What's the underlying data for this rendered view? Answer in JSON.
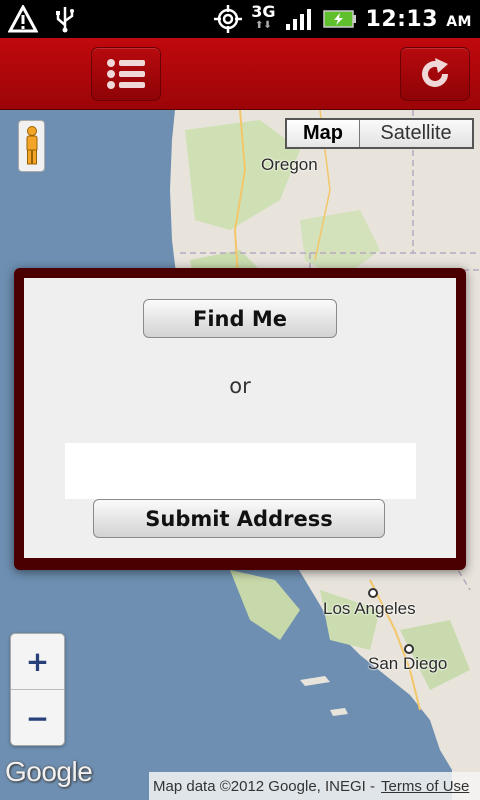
{
  "status_bar": {
    "network": "3G",
    "time": "12:13",
    "ampm": "AM"
  },
  "toolbar": {
    "buttons": [
      {
        "icon": "map-icon"
      },
      {
        "icon": "list-icon"
      },
      {
        "icon": "refresh-icon"
      }
    ],
    "color": "#b00609"
  },
  "map": {
    "type_toggle": {
      "map": "Map",
      "satellite": "Satellite",
      "selected": "Map"
    },
    "labels": {
      "oregon": "Oregon",
      "los_angeles": "Los Angeles",
      "san_diego": "San Diego"
    },
    "zoom": {
      "in": "+",
      "out": "−"
    },
    "logo": "Google",
    "attribution": "Map data ©2012 Google, INEGI -",
    "terms": "Terms of Use"
  },
  "dialog": {
    "find_me": "Find Me",
    "or": "or",
    "address_value": "",
    "address_placeholder": "",
    "submit": "Submit Address",
    "border_color": "#4a0000"
  }
}
